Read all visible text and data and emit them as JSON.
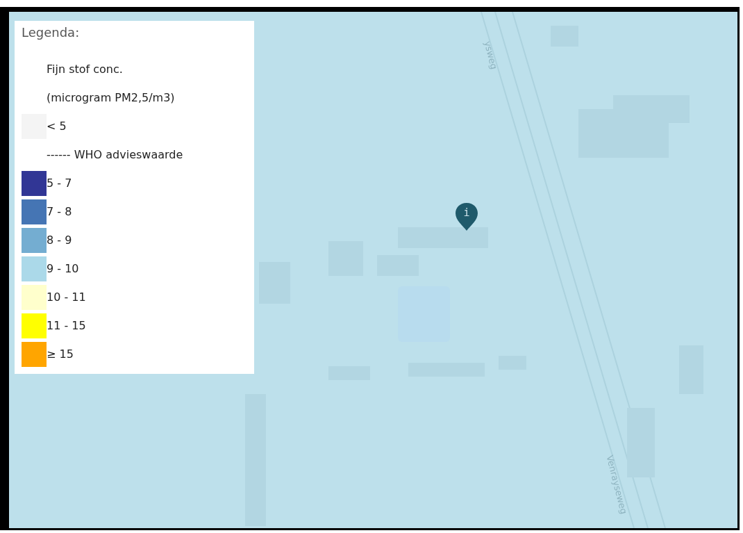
{
  "legend": {
    "title": "Legenda:",
    "items": [
      {
        "kind": "text",
        "label": "Fijn stof conc."
      },
      {
        "kind": "text",
        "label": "(microgram PM2,5/m3)"
      },
      {
        "kind": "swatch",
        "label": "< 5",
        "color": "#f4f4f4"
      },
      {
        "kind": "text",
        "label": "------ WHO advieswaarde"
      },
      {
        "kind": "swatch",
        "label": "5 - 7",
        "color": "#313695"
      },
      {
        "kind": "swatch",
        "label": "7 - 8",
        "color": "#4575b4"
      },
      {
        "kind": "swatch",
        "label": "8 - 9",
        "color": "#74add1"
      },
      {
        "kind": "swatch",
        "label": "9 - 10",
        "color": "#abd9e9"
      },
      {
        "kind": "swatch",
        "label": "10 - 11",
        "color": "#ffffcc"
      },
      {
        "kind": "swatch",
        "label": "11 - 15",
        "color": "#ffff00"
      },
      {
        "kind": "swatch",
        "label": "≥ 15",
        "color": "#ffa500"
      }
    ]
  },
  "map": {
    "street_labels": [
      "ysweg",
      "Venrayseweg"
    ],
    "marker": {
      "glyph": "i"
    }
  }
}
